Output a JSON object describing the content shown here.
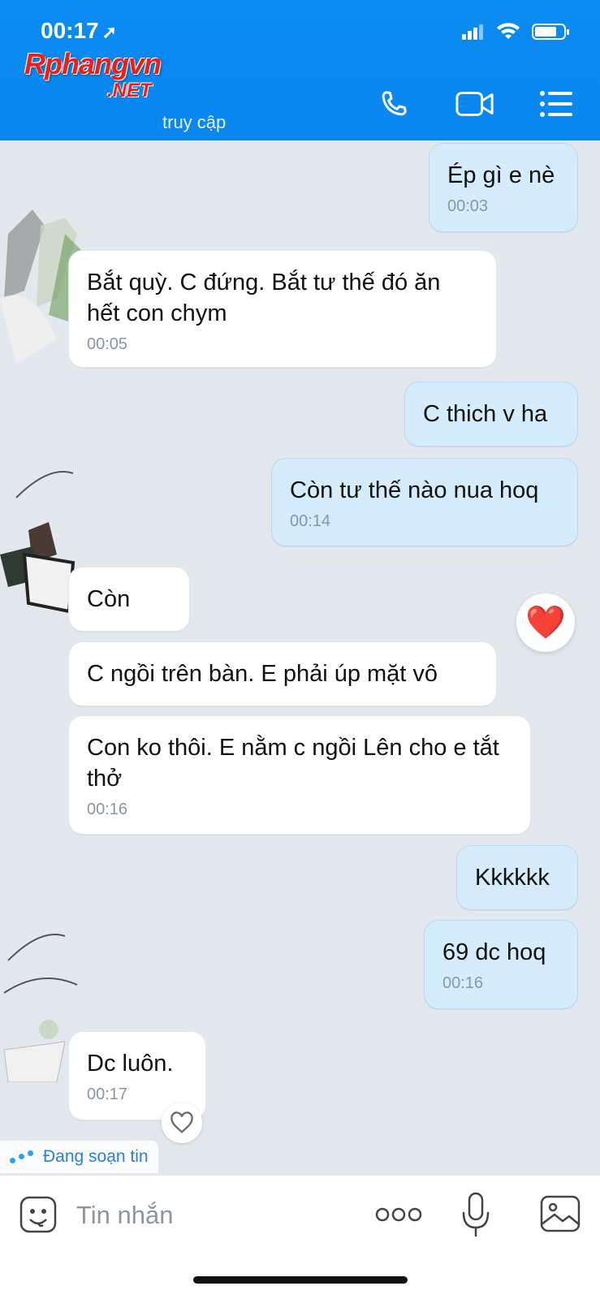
{
  "status_bar": {
    "time": "00:17"
  },
  "header": {
    "watermark_main": "Rphangvn",
    "watermark_sub": ".NET",
    "subtitle": "truy cập"
  },
  "messages": [
    {
      "side": "me",
      "text": "Ép gì e nè",
      "time": "00:03"
    },
    {
      "side": "them",
      "text": "Bắt quỳ. C đứng. Bắt tư thế đó ăn hết con chym",
      "time": "00:05"
    },
    {
      "side": "me",
      "text": "C thich v ha",
      "time": ""
    },
    {
      "side": "me",
      "text": "Còn tư thế nào nua hoq",
      "time": "00:14"
    },
    {
      "side": "them",
      "text": "Còn",
      "time": ""
    },
    {
      "side": "them",
      "text": "C ngồi trên bàn.  E phải úp mặt vô",
      "time": ""
    },
    {
      "side": "them",
      "text": "Con ko thôi.  E nằm c ngồi Lên cho e tắt thở",
      "time": "00:16"
    },
    {
      "side": "me",
      "text": "Kkkkkk",
      "time": ""
    },
    {
      "side": "me",
      "text": "69 dc hoq",
      "time": "00:16"
    },
    {
      "side": "them",
      "text": "Dc luôn.",
      "time": "00:17"
    }
  ],
  "reactions": {
    "heart": "❤️"
  },
  "typing_indicator": "Đang soạn tin",
  "composer": {
    "placeholder": "Tin nhắn"
  },
  "icons": {
    "phone": "phone-icon",
    "video": "video-camera-icon",
    "menu": "list-menu-icon",
    "emoji": "emoji-sticker-icon",
    "more": "more-dots-icon",
    "mic": "microphone-icon",
    "image": "image-gallery-icon"
  },
  "colors": {
    "header": "#0a8cf2",
    "outgoing_bubble": "#d4ecfb",
    "incoming_bubble": "#ffffff",
    "chat_bg": "#e3e8ef"
  }
}
